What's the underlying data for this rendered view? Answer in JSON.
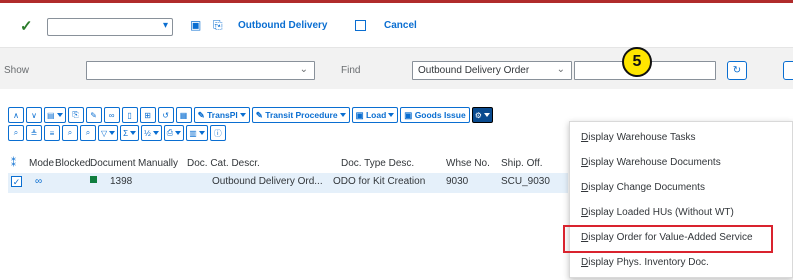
{
  "toolbar": {
    "outbound_delivery_label": "Outbound Delivery",
    "cancel_label": "Cancel"
  },
  "search_bar": {
    "show_label": "Show",
    "find_label": "Find",
    "find_value": "Outbound Delivery Order"
  },
  "annotation": {
    "step_number": "5"
  },
  "action_bar": {
    "transpl_label": "TransPl",
    "transit_procedure_label": "Transit Procedure",
    "load_label": "Load",
    "goods_issue_label": "Goods Issue"
  },
  "table": {
    "columns": [
      "Mode",
      "Blocked",
      "Document",
      "Manually",
      "Doc. Cat. Descr.",
      "Doc. Type Desc.",
      "Whse No.",
      "Ship. Off."
    ],
    "rows": [
      {
        "document": "1398",
        "doc_cat_descr": "Outbound Delivery Ord...",
        "doc_type_desc": "ODO for Kit Creation",
        "whse_no": "9030",
        "ship_off": "SCU_9030"
      }
    ]
  },
  "menu": {
    "items": [
      "Display Warehouse Tasks",
      "Display Warehouse Documents",
      "Display Change Documents",
      "Display Loaded HUs (Without WT)",
      "Display Order for Value-Added Service",
      "Display Phys. Inventory Doc."
    ],
    "highlighted_index": 4
  },
  "colors": {
    "accent": "#0a6ed1",
    "highlight_border": "#d9232e",
    "badge": "#ffe600"
  }
}
